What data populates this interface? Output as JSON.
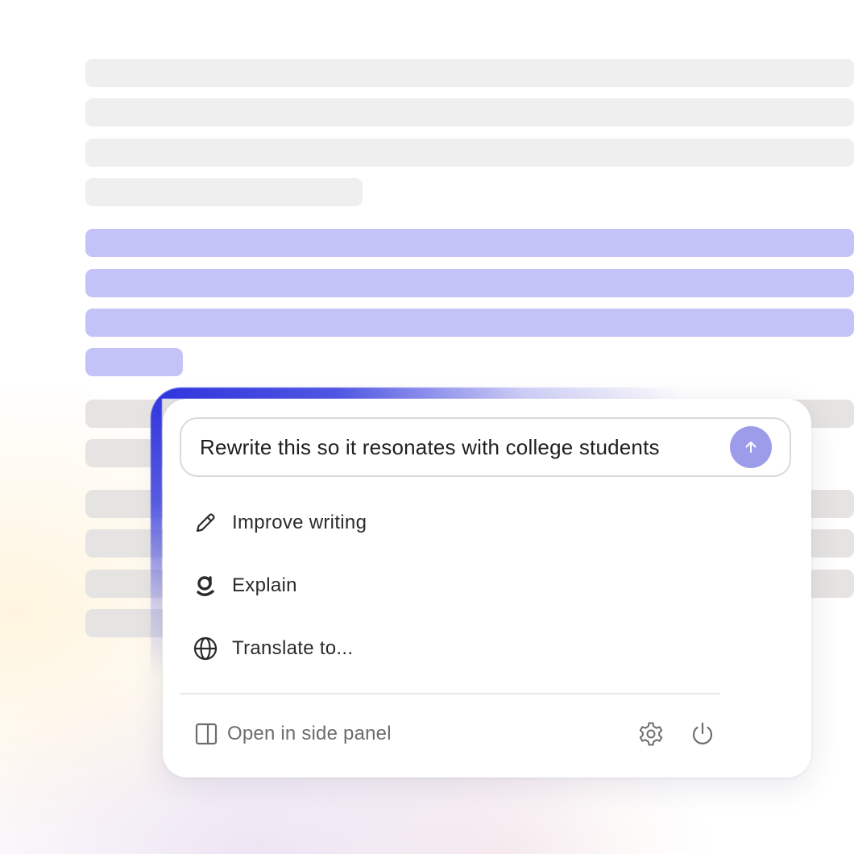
{
  "prompt": {
    "text": "Rewrite this so it resonates with college students"
  },
  "send_button": {
    "icon": "arrow-up-icon",
    "color": "#9c9cea"
  },
  "menu": {
    "items": [
      {
        "label": "Improve writing",
        "icon": "pencil-icon"
      },
      {
        "label": "Explain",
        "icon": "explain-g-icon"
      },
      {
        "label": "Translate to...",
        "icon": "globe-icon"
      }
    ]
  },
  "footer": {
    "side_panel_label": "Open in side panel",
    "side_panel_icon": "side-panel-icon",
    "settings_icon": "gear-icon",
    "power_icon": "power-icon"
  },
  "colors": {
    "accent": "#2f35e0",
    "highlight": "#c3c3f7",
    "placeholder_line": "#efefef"
  }
}
